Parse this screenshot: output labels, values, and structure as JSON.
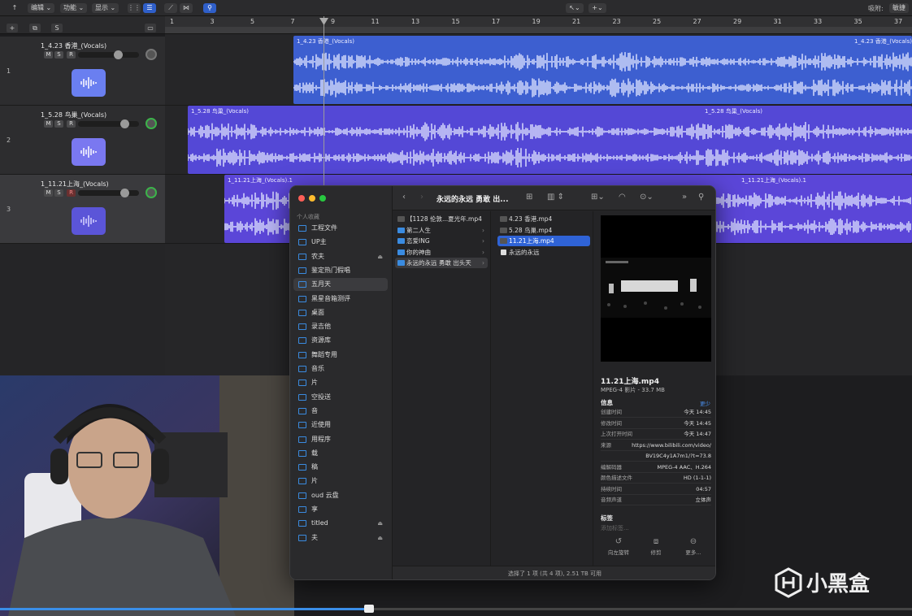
{
  "toolbar": {
    "menu_edit": "编辑",
    "menu_function": "功能",
    "menu_view": "显示",
    "snap_label": "吸附:",
    "snap_value": "敏捷"
  },
  "track_header": {
    "add": "+",
    "dup": "⧉",
    "solo": "S"
  },
  "ruler": {
    "marks": [
      "1",
      "3",
      "5",
      "7",
      "9",
      "11",
      "13",
      "15",
      "17",
      "19",
      "21",
      "23",
      "25",
      "27",
      "29",
      "31",
      "33",
      "35",
      "37"
    ]
  },
  "tracks": [
    {
      "num": "1",
      "name": "1_4.23 香港_(Vocals)",
      "region_label": "1_4.23 香港_(Vocals)",
      "region_label2": "1_4.23 香港_(Vocals)"
    },
    {
      "num": "2",
      "name": "1_5.28 鸟巢_(Vocals)",
      "region_label": "1_5.28 鸟巢_(Vocals)",
      "region_label2": "1_5.28 鸟巢_(Vocals)"
    },
    {
      "num": "3",
      "name": "1_11.21上海_(Vocals)",
      "region_label": "1_11.21上海_(Vocals).1",
      "region_label2": "1_11.21上海_(Vocals).1"
    }
  ],
  "msr": {
    "m": "M",
    "s": "S",
    "r": "R"
  },
  "finder": {
    "title": "永远的永远 勇敢 出...",
    "sidebar_section": "个人收藏",
    "sidebar": [
      {
        "label": "工程文件"
      },
      {
        "label": "UP主"
      },
      {
        "label": "农夫",
        "eject": "⏏"
      },
      {
        "label": "鉴定热门假唱"
      },
      {
        "label": "五月天"
      },
      {
        "label": "黑星音箱测评"
      },
      {
        "label": "桌面"
      },
      {
        "label": "录吉他"
      },
      {
        "label": "资源库"
      },
      {
        "label": "舞蹈专用"
      },
      {
        "label": "音乐"
      },
      {
        "label": "片"
      },
      {
        "label": "空投送"
      },
      {
        "label": "音"
      },
      {
        "label": "近使用"
      },
      {
        "label": "用程序"
      },
      {
        "label": "载"
      },
      {
        "label": "稿"
      },
      {
        "label": "片"
      },
      {
        "label": "oud 云盘"
      },
      {
        "label": "享"
      },
      {
        "label": "titled",
        "eject": "⏏"
      },
      {
        "label": "夫",
        "eject": "⏏"
      }
    ],
    "col1": [
      {
        "label": "【1128 伦敦...夏光年.mp4",
        "kind": "file"
      },
      {
        "label": "第二人生",
        "kind": "folder"
      },
      {
        "label": "恋爱ING",
        "kind": "folder"
      },
      {
        "label": "你的神曲",
        "kind": "folder"
      },
      {
        "label": "永远的永远 勇敢 出头天",
        "kind": "folder"
      }
    ],
    "col2": [
      {
        "label": "4.23 香港.mp4",
        "kind": "file"
      },
      {
        "label": "5.28 鸟巢.mp4",
        "kind": "file"
      },
      {
        "label": "11.21上海.mp4",
        "kind": "file"
      },
      {
        "label": "永远的永远",
        "kind": "doc"
      }
    ],
    "preview": {
      "filename": "11.21上海.mp4",
      "kind": "MPEG-4 影片 - 33.7 MB",
      "info_heading": "信息",
      "less_link": "更少",
      "rows": [
        {
          "k": "创建时间",
          "v": "今天 14:45"
        },
        {
          "k": "修改时间",
          "v": "今天 14:45"
        },
        {
          "k": "上次打开时间",
          "v": "今天 14:47"
        },
        {
          "k": "来源",
          "v": "https://www.bilibili.com/video/"
        },
        {
          "k": "",
          "v": "BV19C4y1A7m1/?t=73.8"
        },
        {
          "k": "编解码器",
          "v": "MPEG-4 AAC、H.264"
        },
        {
          "k": "颜色描述文件",
          "v": "HD (1-1-1)"
        },
        {
          "k": "持续时间",
          "v": "04:57"
        },
        {
          "k": "音频声道",
          "v": "立体声"
        }
      ],
      "tags_heading": "标签",
      "tags_placeholder": "添加标签...",
      "actions": [
        {
          "label": "向左旋转",
          "icon": "↺"
        },
        {
          "label": "修剪",
          "icon": "⧈"
        },
        {
          "label": "更多...",
          "icon": "⊖"
        }
      ]
    },
    "status": "选择了 1 项 (共 4 项), 2.51 TB 可用"
  },
  "video": {
    "progress": 0.4
  },
  "watermark": {
    "text": "小黑盒"
  },
  "colors": {
    "region_blue": "#3d5fd0",
    "region_purple": "#5b46d8",
    "selection": "#2f63d6"
  }
}
